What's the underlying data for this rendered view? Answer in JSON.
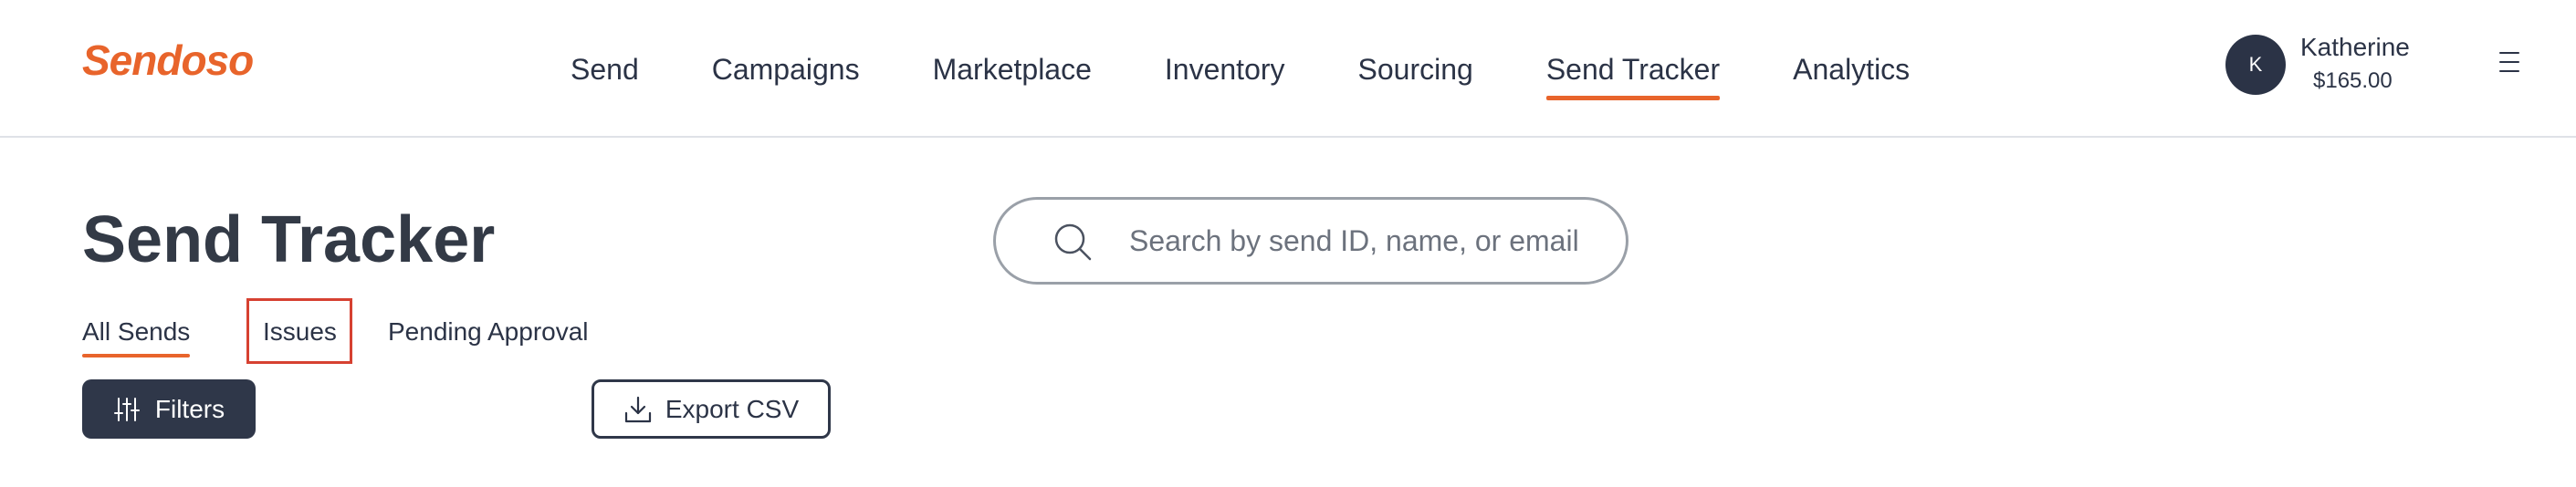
{
  "brand": {
    "name": "Sendoso",
    "accent_color": "#e8642b"
  },
  "nav": {
    "items": [
      {
        "label": "Send",
        "active": false
      },
      {
        "label": "Campaigns",
        "active": false
      },
      {
        "label": "Marketplace",
        "active": false
      },
      {
        "label": "Inventory",
        "active": false
      },
      {
        "label": "Sourcing",
        "active": false
      },
      {
        "label": "Send Tracker",
        "active": true
      },
      {
        "label": "Analytics",
        "active": false
      }
    ]
  },
  "user": {
    "initial": "K",
    "name": "Katherine",
    "balance": "$165.00"
  },
  "page": {
    "title": "Send Tracker"
  },
  "search": {
    "placeholder": "Search by send ID, name, or email",
    "value": ""
  },
  "tabs": [
    {
      "label": "All Sends",
      "active": true
    },
    {
      "label": "Issues",
      "active": false,
      "highlighted": true
    },
    {
      "label": "Pending Approval",
      "active": false
    }
  ],
  "actions": {
    "filters_label": "Filters",
    "export_label": "Export CSV"
  },
  "icons": {
    "menu": "hamburger-menu-icon",
    "search": "search-icon",
    "filters": "sliders-icon",
    "export": "download-icon"
  }
}
